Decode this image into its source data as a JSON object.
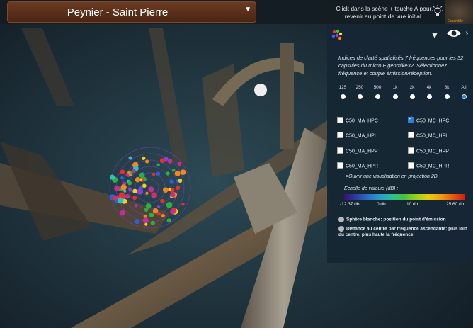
{
  "header": {
    "location_select": "Peynier - Saint Pierre",
    "hint": "Click dans la scène + touche A pour revenir au point de vue initial.",
    "thumbnail_label": "Essemble"
  },
  "panel": {
    "description": "Indices de clarté spatialisés 7 fréquences pour les 32 capsules du micro Eigenmike32. Sélectionnez fréquence et couple émission/réception.",
    "frequencies": [
      "125",
      "250",
      "500",
      "1k",
      "2k",
      "4k",
      "8k",
      "All"
    ],
    "selected_frequency": "All",
    "options": [
      {
        "label": "C50_MA_HPC",
        "checked": false
      },
      {
        "label": "C50_MC_HPC",
        "checked": true
      },
      {
        "label": "C50_MA_HPL",
        "checked": false
      },
      {
        "label": "C50_MC_HPL",
        "checked": false
      },
      {
        "label": "C50_MA_HPP",
        "checked": false
      },
      {
        "label": "C50_MC_HPP",
        "checked": false
      },
      {
        "label": "C50_MA_HPR",
        "checked": false
      },
      {
        "label": "C50_MC_HPR",
        "checked": false
      }
    ],
    "projection_link": ">Ouvrir une visualisation en projection 2D",
    "scale_title": "Echelle de valeurs (dB)  :",
    "scale_ticks": [
      "-12.37 db",
      "0 db",
      "10 db",
      "25.60 db"
    ],
    "note_white_sphere": "Sphère blanche: position du point d'émission",
    "note_distance": "Distance au centre par fréquence ascendante: plus loin du centre, plus haute la fréquence"
  },
  "colors": {
    "panel_bg": "#162634",
    "select_bg": "#5a2e18",
    "accent": "#2b7fd6"
  }
}
